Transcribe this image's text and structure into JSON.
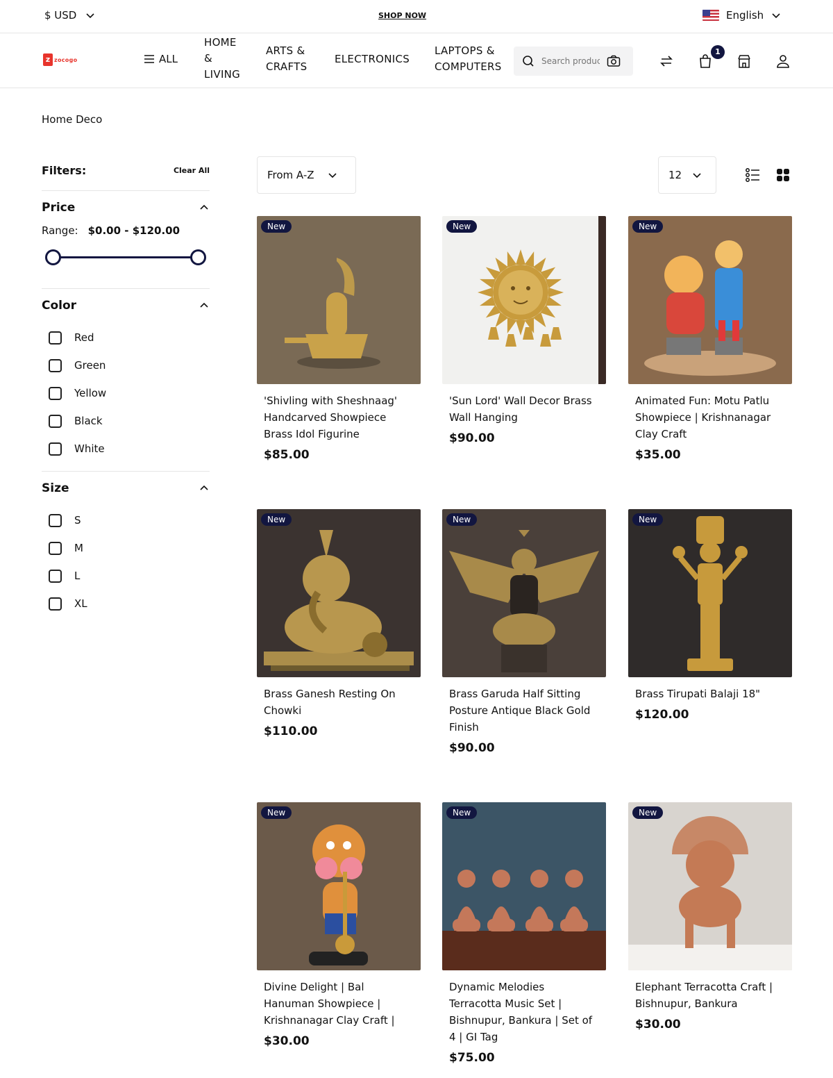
{
  "topbar": {
    "currency": "$ USD",
    "shop_now": "SHOP NOW",
    "language": "English"
  },
  "header": {
    "logo_text": "zocogo",
    "all_label": "ALL",
    "nav": [
      {
        "label": "HOME & LIVING"
      },
      {
        "label": "ARTS & CRAFTS"
      },
      {
        "label": "ELECTRONICS"
      },
      {
        "label": "LAPTOPS & COMPUTERS"
      }
    ],
    "search_placeholder": "Search products",
    "cart_count": "1"
  },
  "breadcrumb": "Home Deco",
  "filters": {
    "title": "Filters:",
    "clear_all": "Clear All",
    "price": {
      "title": "Price",
      "range_label": "Range:",
      "range_value": "$0.00 - $120.00",
      "min_fraction": 0,
      "max_fraction": 1
    },
    "color": {
      "title": "Color",
      "options": [
        "Red",
        "Green",
        "Yellow",
        "Black",
        "White"
      ]
    },
    "size": {
      "title": "Size",
      "options": [
        "S",
        "M",
        "L",
        "XL"
      ]
    }
  },
  "toolbar": {
    "sort_value": "From A-Z",
    "per_page_value": "12"
  },
  "products": [
    {
      "badge": "New",
      "title": "'Shivling with Sheshnaag' Handcarved Showpiece Brass Idol Figurine",
      "price": "$85.00",
      "bg": "#7a6a55",
      "fg": "#c9a24a"
    },
    {
      "badge": "New",
      "title": "'Sun Lord' Wall Decor Brass Wall Hanging",
      "price": "$90.00",
      "bg": "#f1f1ef",
      "fg": "#c89b3c"
    },
    {
      "badge": "New",
      "title": "Animated Fun: Motu Patlu Showpiece | Krishnanagar Clay Craft",
      "price": "$35.00",
      "bg": "#8a6a4d",
      "fg": "#d9473b"
    },
    {
      "badge": "New",
      "title": "Brass Ganesh Resting On Chowki",
      "price": "$110.00",
      "bg": "#3b3330",
      "fg": "#b8974e"
    },
    {
      "badge": "New",
      "title": "Brass Garuda Half Sitting Posture Antique Black Gold Finish",
      "price": "$90.00",
      "bg": "#4a403a",
      "fg": "#a88a4a"
    },
    {
      "badge": "New",
      "title": "Brass Tirupati Balaji 18\"",
      "price": "$120.00",
      "bg": "#2f2b2a",
      "fg": "#c79a3c"
    },
    {
      "badge": "New",
      "title": "Divine Delight | Bal Hanuman Showpiece | Krishnanagar Clay Craft |",
      "price": "$30.00",
      "bg": "#6b5a4a",
      "fg": "#e0903c"
    },
    {
      "badge": "New",
      "title": "Dynamic Melodies Terracotta Music Set | Bishnupur, Bankura | Set of 4 | GI Tag",
      "price": "$75.00",
      "bg": "#3c5566",
      "fg": "#c4785a"
    },
    {
      "badge": "New",
      "title": "Elephant Terracotta Craft | Bishnupur, Bankura",
      "price": "$30.00",
      "bg": "#d8d4cf",
      "fg": "#c47a55"
    }
  ]
}
